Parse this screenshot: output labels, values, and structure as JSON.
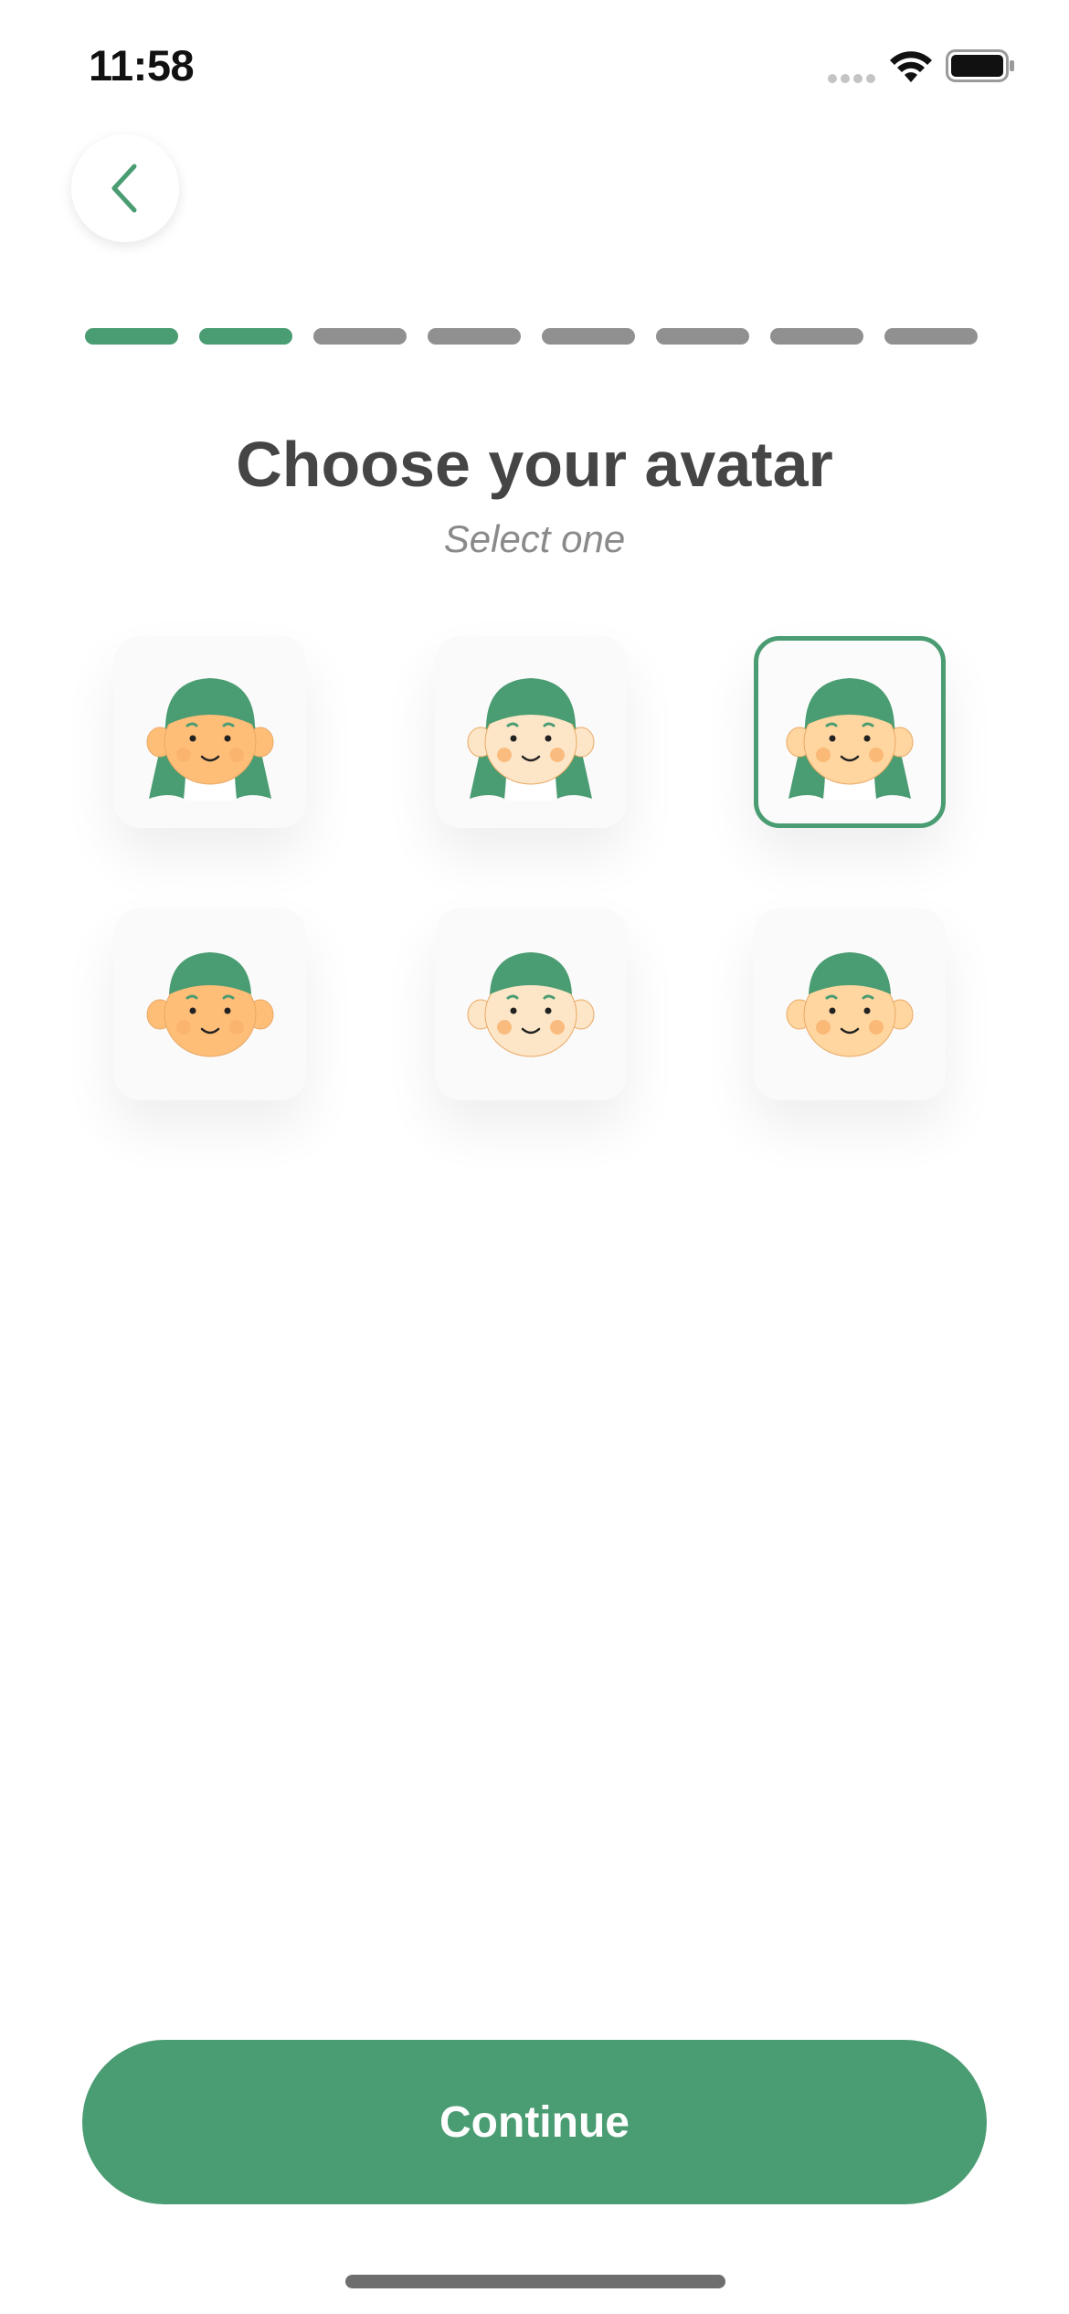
{
  "status_bar": {
    "time": "11:58",
    "icons": [
      "signal-dots-icon",
      "wifi-icon",
      "battery-icon"
    ]
  },
  "nav": {
    "back_icon": "chevron-left-icon"
  },
  "progress": {
    "total_steps": 8,
    "completed_steps": 2,
    "active_color": "#4a9c72",
    "inactive_color": "#909090"
  },
  "header": {
    "title": "Choose your avatar",
    "subtitle": "Select one"
  },
  "avatars": [
    {
      "id": "girl-tan",
      "hair": "long",
      "skin": "#ffbe78",
      "selected": false
    },
    {
      "id": "girl-light",
      "hair": "long",
      "skin": "#fde6c8",
      "selected": false
    },
    {
      "id": "girl-medium",
      "hair": "long",
      "skin": "#ffd6a0",
      "selected": true
    },
    {
      "id": "boy-tan",
      "hair": "short",
      "skin": "#ffbe78",
      "selected": false
    },
    {
      "id": "boy-light",
      "hair": "short",
      "skin": "#fde6c8",
      "selected": false
    },
    {
      "id": "boy-medium",
      "hair": "short",
      "skin": "#ffd6a0",
      "selected": false
    }
  ],
  "colors": {
    "accent": "#4a9c72",
    "hair": "#4a9c72",
    "cheek": "#f9b16b"
  },
  "footer": {
    "continue_label": "Continue"
  }
}
